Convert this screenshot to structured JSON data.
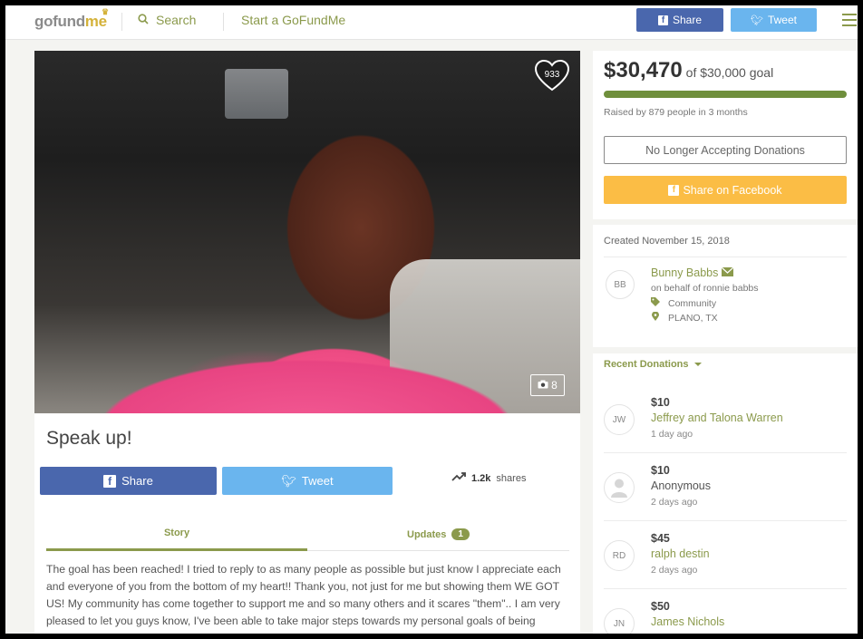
{
  "header": {
    "logo_go": "gofund",
    "logo_me": "me",
    "search_label": "Search",
    "start_label": "Start a GoFundMe",
    "share_label": "Share",
    "tweet_label": "Tweet"
  },
  "campaign": {
    "heart_count": "933",
    "photo_count": "8",
    "title": "Speak up!",
    "share_label": "Share",
    "tweet_label": "Tweet",
    "shares_count": "1.2k",
    "shares_suffix": "shares",
    "tabs": {
      "story": "Story",
      "updates": "Updates",
      "updates_count": "1"
    },
    "story_text": "The goal has been reached! I tried to reply to as many people as possible but just know I appreciate each and everyone of you from the bottom of my heart!! Thank you, not just for me but showing them WE GOT US! My community has come together to support me and so many others and it scares \"them\".. I am very pleased to let you guys know, I've been able to take major steps towards my personal goals of being"
  },
  "sidebar": {
    "raised_amount": "$30,470",
    "goal_text": "of $30,000 goal",
    "progress_fraction": 1.0,
    "raised_by": "Raised by 879 people in 3 months",
    "no_longer_label": "No Longer Accepting Donations",
    "share_facebook_label": "Share on Facebook",
    "created": "Created November 15, 2018",
    "organizer_initials": "BB",
    "organizer_name": "Bunny Babbs",
    "on_behalf": "on behalf of ronnie babbs",
    "category": "Community",
    "location": "PLANO, TX",
    "recent_donations_label": "Recent Donations",
    "donations": [
      {
        "initials": "JW",
        "amount": "$10",
        "name": "Jeffrey and Talona Warren",
        "when": "1 day ago"
      },
      {
        "initials": "",
        "amount": "$10",
        "name": "Anonymous",
        "when": "2 days ago"
      },
      {
        "initials": "RD",
        "amount": "$45",
        "name": "ralph destin",
        "when": "2 days ago"
      },
      {
        "initials": "JN",
        "amount": "$50",
        "name": "James Nichols",
        "when": ""
      }
    ]
  },
  "colors": {
    "brand_green": "#8b9a4c",
    "progress_green": "#6f8f3c",
    "facebook_blue": "#4a67ad",
    "twitter_blue": "#6ab5ee",
    "share_yellow": "#fbbd45"
  }
}
